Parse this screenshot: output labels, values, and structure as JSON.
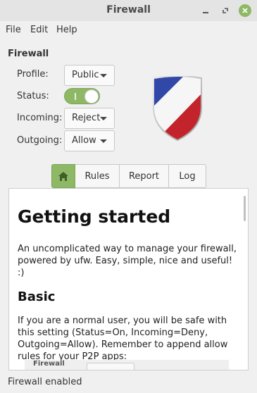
{
  "window": {
    "title": "Firewall",
    "accent": "#8fb866",
    "buttons": [
      "minimize-icon",
      "maximize-icon",
      "close-icon"
    ]
  },
  "menu": {
    "items": [
      {
        "label": "File"
      },
      {
        "label": "Edit"
      },
      {
        "label": "Help"
      }
    ]
  },
  "firewall": {
    "section_title": "Firewall",
    "profile_label": "Profile:",
    "profile_value": "Public",
    "status_label": "Status:",
    "status_on": true,
    "incoming_label": "Incoming:",
    "incoming_value": "Reject",
    "outgoing_label": "Outgoing:",
    "outgoing_value": "Allow"
  },
  "tabs": [
    {
      "label": "",
      "icon": "home-icon",
      "active": true
    },
    {
      "label": "Rules",
      "active": false
    },
    {
      "label": "Report",
      "active": false
    },
    {
      "label": "Log",
      "active": false
    }
  ],
  "content": {
    "heading": "Getting started",
    "intro": "An uncomplicated way to manage your firewall, powered by ufw. Easy, simple, nice and useful! :)",
    "subheading": "Basic",
    "basic_text": "If you are a normal user, you will be safe with this setting (Status=On, Incoming=Deny, Outgoing=Allow). Remember to append allow rules for your P2P apps:",
    "preview_caption": "Firewall"
  },
  "status": {
    "text": "Firewall enabled"
  }
}
